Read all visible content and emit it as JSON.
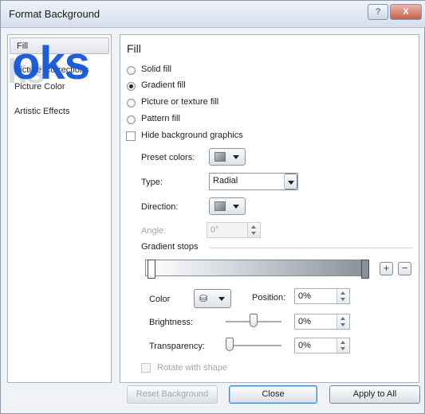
{
  "window": {
    "title": "Format Background",
    "help_label": "?",
    "close_label": "X"
  },
  "watermark": {
    "text": "oks",
    "ghost_text": "ks"
  },
  "sidebar": {
    "items": [
      {
        "label": "Fill",
        "selected": true
      },
      {
        "label": "Picture Corrections",
        "selected": false
      },
      {
        "label": "Picture Color",
        "selected": false
      },
      {
        "label": "Artistic Effects",
        "selected": false
      }
    ]
  },
  "fill": {
    "heading": "Fill",
    "options": [
      {
        "label": "Solid fill",
        "checked": false
      },
      {
        "label": "Gradient fill",
        "checked": true
      },
      {
        "label": "Picture or texture fill",
        "checked": false
      },
      {
        "label": "Pattern fill",
        "checked": false
      }
    ],
    "hide_background": {
      "label": "Hide background graphics",
      "checked": false
    },
    "preset_colors": {
      "label": "Preset colors:"
    },
    "type": {
      "label": "Type:",
      "value": "Radial"
    },
    "direction": {
      "label": "Direction:"
    },
    "angle": {
      "label": "Angle:",
      "value": "0°"
    },
    "gradient_stops": {
      "label": "Gradient stops",
      "add_label": "+",
      "remove_label": "−"
    },
    "color": {
      "label": "Color"
    },
    "position": {
      "label": "Position:",
      "value": "0%"
    },
    "brightness": {
      "label": "Brightness:",
      "value": "0%",
      "level": 0.5
    },
    "transparency": {
      "label": "Transparency:",
      "value": "0%",
      "level": 0.0
    },
    "rotate": {
      "label": "Rotate with shape",
      "checked": false
    }
  },
  "footer": {
    "reset_label": "Reset Background",
    "close_label": "Close",
    "apply_label": "Apply to All"
  }
}
